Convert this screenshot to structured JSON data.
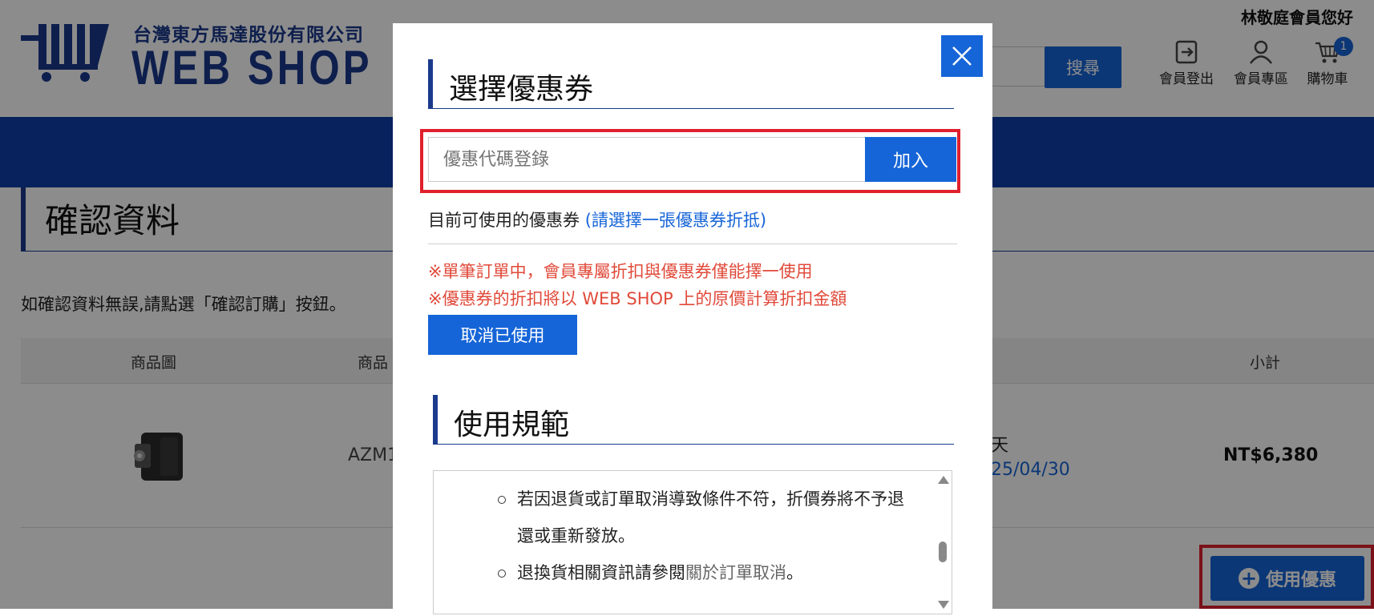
{
  "header": {
    "company_name": "台灣東方馬達股份有限公司",
    "brand": "WEB SHOP",
    "greeting": "林敬庭會員您好",
    "search_button": "搜尋",
    "logout_label": "會員登出",
    "member_label": "會員專區",
    "cart_label": "購物車",
    "cart_count": "1"
  },
  "page": {
    "title": "確認資料",
    "instruction": "如確認資料無誤,請點選「確認訂購」按鈕。",
    "table_headers": {
      "image": "商品圖",
      "product": "商品",
      "subtotal": "小計"
    },
    "row": {
      "model": "AZM1",
      "delivery_suffix": "天",
      "date_partial": "25/04/30",
      "price": "NT$6,380"
    },
    "use_coupon_button": "使用優惠"
  },
  "modal": {
    "title": "選擇優惠券",
    "code_placeholder": "優惠代碼登錄",
    "add_button": "加入",
    "available_label": "目前可使用的優惠券",
    "available_hint": "(請選擇一張優惠券折抵)",
    "warning_1": "※單筆訂單中，會員專屬折扣與優惠券僅能擇一使用",
    "warning_2": "※優惠券的折扣將以 WEB SHOP 上的原價計算折扣金額",
    "cancel_button": "取消已使用",
    "rules_title": "使用規範",
    "rules": [
      "若因退貨或訂單取消導致條件不符，折價券將不予退還或重新發放。",
      {
        "text": "退換貨相關資訊請參閱",
        "link": "關於訂單取消",
        "tail": "。"
      }
    ]
  },
  "colors": {
    "accent": "#1665d8",
    "brand_navy": "#1a3a8c",
    "nav_bar": "#0d3fa8",
    "warning_red": "#e04a3a",
    "highlight_red": "#e0202c"
  }
}
